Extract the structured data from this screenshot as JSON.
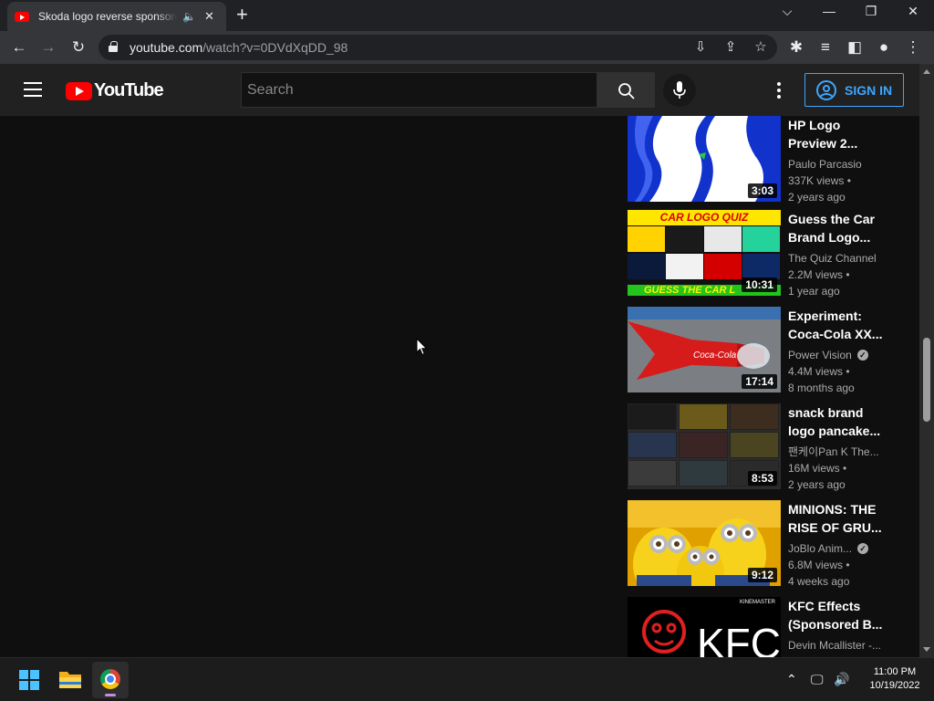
{
  "browser": {
    "tab_title": "Skoda logo reverse sponsored",
    "tab_close": "✕",
    "new_tab": "+",
    "url_host": "youtube.com",
    "url_path": "/watch?v=0DVdXqDD_98",
    "window_controls": [
      "⌵",
      "—",
      "❐",
      "✕"
    ]
  },
  "youtube": {
    "logo_text": "YouTube",
    "search_placeholder": "Search",
    "signin_label": "SIGN IN",
    "recommendations": [
      {
        "title": "HP Logo Preview 2...",
        "channel": "Paulo Parcasio",
        "views": "337K views •",
        "age": "2 years ago",
        "duration": "3:03",
        "verified": false
      },
      {
        "title": "Guess the Car Brand Logo...",
        "channel": "The Quiz Channel",
        "views": "2.2M views •",
        "age": "1 year ago",
        "duration": "10:31",
        "verified": false,
        "banner": "CAR LOGO QUIZ",
        "footer": "GUESS THE CAR L"
      },
      {
        "title": "Experiment: Coca-Cola XX...",
        "channel": "Power Vision",
        "views": "4.4M views •",
        "age": "8 months ago",
        "duration": "17:14",
        "verified": true
      },
      {
        "title": "snack brand logo pancake...",
        "channel": "팬케이Pan K The...",
        "views": "16M views •",
        "age": "2 years ago",
        "duration": "8:53",
        "verified": false
      },
      {
        "title": "MINIONS: THE RISE OF GRU...",
        "channel": "JoBlo Anim...",
        "views": "6.8M views •",
        "age": "4 weeks ago",
        "duration": "9:12",
        "verified": true
      },
      {
        "title": "KFC Effects (Sponsored B...",
        "channel": "Devin Mcallister -...",
        "views": "",
        "age": "",
        "duration": "",
        "verified": false,
        "thumb_text": "KFC",
        "thumb_corner": "KINEMASTER"
      }
    ]
  },
  "taskbar": {
    "time": "11:00 PM",
    "date": "10/19/2022"
  }
}
